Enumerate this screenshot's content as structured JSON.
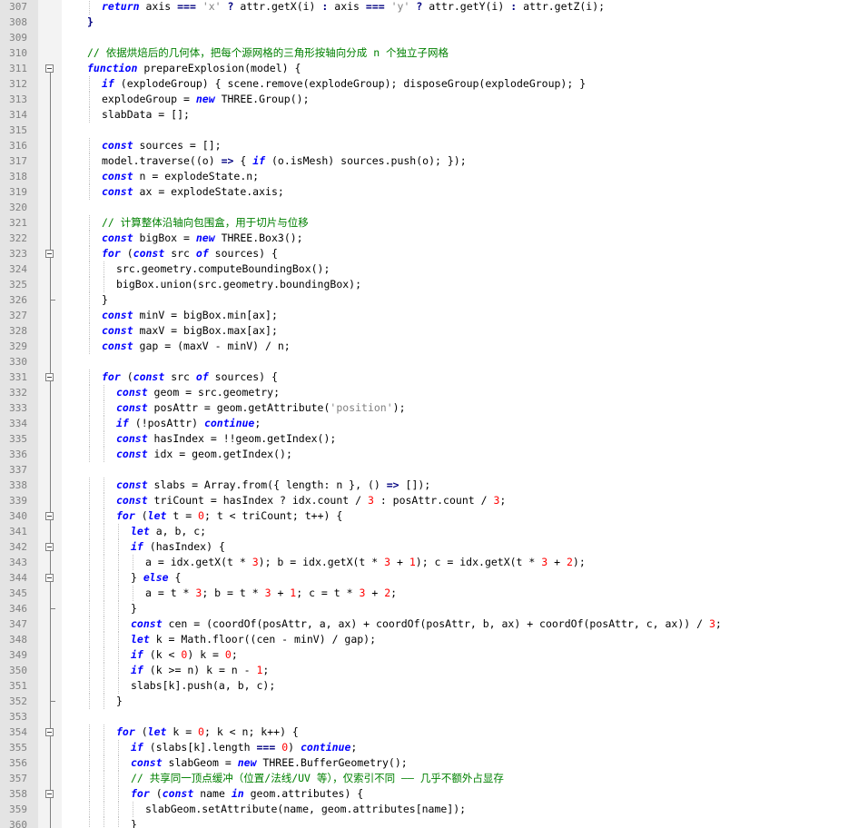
{
  "editor": {
    "first_line": 307,
    "lines": [
      {
        "n": "307",
        "indent": 4,
        "t": [
          [
            "kw",
            "return"
          ],
          [
            "p",
            " axis "
          ],
          [
            "op",
            "==="
          ],
          [
            "p",
            " "
          ],
          [
            "str",
            "'x'"
          ],
          [
            "p",
            " "
          ],
          [
            "op",
            "?"
          ],
          [
            "p",
            " attr.getX(i) "
          ],
          [
            "op",
            ":"
          ],
          [
            "p",
            " axis "
          ],
          [
            "op",
            "==="
          ],
          [
            "p",
            " "
          ],
          [
            "str",
            "'y'"
          ],
          [
            "p",
            " "
          ],
          [
            "op",
            "?"
          ],
          [
            "p",
            " attr.getY(i) "
          ],
          [
            "op",
            ":"
          ],
          [
            "p",
            " attr.getZ(i);"
          ]
        ]
      },
      {
        "n": "308",
        "indent": 2,
        "t": [
          [
            "op",
            "}"
          ]
        ]
      },
      {
        "n": "309",
        "indent": 0,
        "t": []
      },
      {
        "n": "310",
        "indent": 2,
        "t": [
          [
            "cm",
            "// 依据烘焙后的几何体，把每个源网格的三角形按轴向分成 n 个独立子网格"
          ]
        ]
      },
      {
        "n": "311",
        "indent": 2,
        "fold": "open",
        "t": [
          [
            "kw",
            "function"
          ],
          [
            "p",
            " prepareExplosion(model) {"
          ]
        ]
      },
      {
        "n": "312",
        "indent": 4,
        "t": [
          [
            "kw",
            "if"
          ],
          [
            "p",
            " (explodeGroup) { scene.remove(explodeGroup); disposeGroup(explodeGroup); }"
          ]
        ]
      },
      {
        "n": "313",
        "indent": 4,
        "t": [
          [
            "p",
            "explodeGroup = "
          ],
          [
            "kw",
            "new"
          ],
          [
            "p",
            " THREE.Group();"
          ]
        ]
      },
      {
        "n": "314",
        "indent": 4,
        "t": [
          [
            "p",
            "slabData = [];"
          ]
        ]
      },
      {
        "n": "315",
        "indent": 0,
        "t": []
      },
      {
        "n": "316",
        "indent": 4,
        "t": [
          [
            "kw",
            "const"
          ],
          [
            "p",
            " sources = [];"
          ]
        ]
      },
      {
        "n": "317",
        "indent": 4,
        "t": [
          [
            "p",
            "model.traverse((o) "
          ],
          [
            "op",
            "=>"
          ],
          [
            "p",
            " { "
          ],
          [
            "kw",
            "if"
          ],
          [
            "p",
            " (o.isMesh) sources.push(o); });"
          ]
        ]
      },
      {
        "n": "318",
        "indent": 4,
        "t": [
          [
            "kw",
            "const"
          ],
          [
            "p",
            " n = explodeState.n;"
          ]
        ]
      },
      {
        "n": "319",
        "indent": 4,
        "t": [
          [
            "kw",
            "const"
          ],
          [
            "p",
            " ax = explodeState.axis;"
          ]
        ]
      },
      {
        "n": "320",
        "indent": 0,
        "t": []
      },
      {
        "n": "321",
        "indent": 4,
        "t": [
          [
            "cm",
            "// 计算整体沿轴向包围盒，用于切片与位移"
          ]
        ]
      },
      {
        "n": "322",
        "indent": 4,
        "t": [
          [
            "kw",
            "const"
          ],
          [
            "p",
            " bigBox = "
          ],
          [
            "kw",
            "new"
          ],
          [
            "p",
            " THREE.Box3();"
          ]
        ]
      },
      {
        "n": "323",
        "indent": 4,
        "fold": "open",
        "t": [
          [
            "kw",
            "for"
          ],
          [
            "p",
            " ("
          ],
          [
            "kw",
            "const"
          ],
          [
            "p",
            " src "
          ],
          [
            "kw",
            "of"
          ],
          [
            "p",
            " sources) {"
          ]
        ]
      },
      {
        "n": "324",
        "indent": 6,
        "t": [
          [
            "p",
            "src.geometry.computeBoundingBox();"
          ]
        ]
      },
      {
        "n": "325",
        "indent": 6,
        "t": [
          [
            "p",
            "bigBox.union(src.geometry.boundingBox);"
          ]
        ]
      },
      {
        "n": "326",
        "indent": 4,
        "fold": "end",
        "t": [
          [
            "p",
            "}"
          ]
        ]
      },
      {
        "n": "327",
        "indent": 4,
        "t": [
          [
            "kw",
            "const"
          ],
          [
            "p",
            " minV = bigBox.min[ax];"
          ]
        ]
      },
      {
        "n": "328",
        "indent": 4,
        "t": [
          [
            "kw",
            "const"
          ],
          [
            "p",
            " maxV = bigBox.max[ax];"
          ]
        ]
      },
      {
        "n": "329",
        "indent": 4,
        "t": [
          [
            "kw",
            "const"
          ],
          [
            "p",
            " gap = (maxV - minV) / n;"
          ]
        ]
      },
      {
        "n": "330",
        "indent": 0,
        "t": []
      },
      {
        "n": "331",
        "indent": 4,
        "fold": "open",
        "t": [
          [
            "kw",
            "for"
          ],
          [
            "p",
            " ("
          ],
          [
            "kw",
            "const"
          ],
          [
            "p",
            " src "
          ],
          [
            "kw",
            "of"
          ],
          [
            "p",
            " sources) {"
          ]
        ]
      },
      {
        "n": "332",
        "indent": 6,
        "t": [
          [
            "kw",
            "const"
          ],
          [
            "p",
            " geom = src.geometry;"
          ]
        ]
      },
      {
        "n": "333",
        "indent": 6,
        "t": [
          [
            "kw",
            "const"
          ],
          [
            "p",
            " posAttr = geom.getAttribute("
          ],
          [
            "str",
            "'position'"
          ],
          [
            "p",
            ");"
          ]
        ]
      },
      {
        "n": "334",
        "indent": 6,
        "t": [
          [
            "kw",
            "if"
          ],
          [
            "p",
            " (!posAttr) "
          ],
          [
            "kw",
            "continue"
          ],
          [
            "p",
            ";"
          ]
        ]
      },
      {
        "n": "335",
        "indent": 6,
        "t": [
          [
            "kw",
            "const"
          ],
          [
            "p",
            " hasIndex = !!geom.getIndex();"
          ]
        ]
      },
      {
        "n": "336",
        "indent": 6,
        "t": [
          [
            "kw",
            "const"
          ],
          [
            "p",
            " idx = geom.getIndex();"
          ]
        ]
      },
      {
        "n": "337",
        "indent": 0,
        "t": []
      },
      {
        "n": "338",
        "indent": 6,
        "t": [
          [
            "kw",
            "const"
          ],
          [
            "p",
            " slabs = Array.from({ length: n }, () "
          ],
          [
            "op",
            "=>"
          ],
          [
            "p",
            " []);"
          ]
        ]
      },
      {
        "n": "339",
        "indent": 6,
        "t": [
          [
            "kw",
            "const"
          ],
          [
            "p",
            " triCount = hasIndex ? idx.count / "
          ],
          [
            "num",
            "3"
          ],
          [
            "p",
            " : posAttr.count / "
          ],
          [
            "num",
            "3"
          ],
          [
            "p",
            ";"
          ]
        ]
      },
      {
        "n": "340",
        "indent": 6,
        "fold": "open",
        "t": [
          [
            "kw",
            "for"
          ],
          [
            "p",
            " ("
          ],
          [
            "kw",
            "let"
          ],
          [
            "p",
            " t = "
          ],
          [
            "num",
            "0"
          ],
          [
            "p",
            "; t < triCount; t++) {"
          ]
        ]
      },
      {
        "n": "341",
        "indent": 8,
        "t": [
          [
            "kw",
            "let"
          ],
          [
            "p",
            " a, b, c;"
          ]
        ]
      },
      {
        "n": "342",
        "indent": 8,
        "fold": "open",
        "t": [
          [
            "kw",
            "if"
          ],
          [
            "p",
            " (hasIndex) {"
          ]
        ]
      },
      {
        "n": "343",
        "indent": 10,
        "t": [
          [
            "p",
            "a = idx.getX(t * "
          ],
          [
            "num",
            "3"
          ],
          [
            "p",
            "); b = idx.getX(t * "
          ],
          [
            "num",
            "3"
          ],
          [
            "p",
            " + "
          ],
          [
            "num",
            "1"
          ],
          [
            "p",
            "); c = idx.getX(t * "
          ],
          [
            "num",
            "3"
          ],
          [
            "p",
            " + "
          ],
          [
            "num",
            "2"
          ],
          [
            "p",
            ");"
          ]
        ]
      },
      {
        "n": "344",
        "indent": 8,
        "fold": "mid",
        "t": [
          [
            "p",
            "} "
          ],
          [
            "kw",
            "else"
          ],
          [
            "p",
            " {"
          ]
        ]
      },
      {
        "n": "345",
        "indent": 10,
        "t": [
          [
            "p",
            "a = t * "
          ],
          [
            "num",
            "3"
          ],
          [
            "p",
            "; b = t * "
          ],
          [
            "num",
            "3"
          ],
          [
            "p",
            " + "
          ],
          [
            "num",
            "1"
          ],
          [
            "p",
            "; c = t * "
          ],
          [
            "num",
            "3"
          ],
          [
            "p",
            " + "
          ],
          [
            "num",
            "2"
          ],
          [
            "p",
            ";"
          ]
        ]
      },
      {
        "n": "346",
        "indent": 8,
        "fold": "end",
        "t": [
          [
            "p",
            "}"
          ]
        ]
      },
      {
        "n": "347",
        "indent": 8,
        "t": [
          [
            "kw",
            "const"
          ],
          [
            "p",
            " cen = (coordOf(posAttr, a, ax) + coordOf(posAttr, b, ax) + coordOf(posAttr, c, ax)) / "
          ],
          [
            "num",
            "3"
          ],
          [
            "p",
            ";"
          ]
        ]
      },
      {
        "n": "348",
        "indent": 8,
        "t": [
          [
            "kw",
            "let"
          ],
          [
            "p",
            " k = Math.floor((cen - minV) / gap);"
          ]
        ]
      },
      {
        "n": "349",
        "indent": 8,
        "t": [
          [
            "kw",
            "if"
          ],
          [
            "p",
            " (k < "
          ],
          [
            "num",
            "0"
          ],
          [
            "p",
            ") k = "
          ],
          [
            "num",
            "0"
          ],
          [
            "p",
            ";"
          ]
        ]
      },
      {
        "n": "350",
        "indent": 8,
        "t": [
          [
            "kw",
            "if"
          ],
          [
            "p",
            " (k >= n) k = n - "
          ],
          [
            "num",
            "1"
          ],
          [
            "p",
            ";"
          ]
        ]
      },
      {
        "n": "351",
        "indent": 8,
        "t": [
          [
            "p",
            "slabs[k].push(a, b, c);"
          ]
        ]
      },
      {
        "n": "352",
        "indent": 6,
        "fold": "end",
        "t": [
          [
            "p",
            "}"
          ]
        ]
      },
      {
        "n": "353",
        "indent": 0,
        "t": []
      },
      {
        "n": "354",
        "indent": 6,
        "fold": "open",
        "t": [
          [
            "kw",
            "for"
          ],
          [
            "p",
            " ("
          ],
          [
            "kw",
            "let"
          ],
          [
            "p",
            " k = "
          ],
          [
            "num",
            "0"
          ],
          [
            "p",
            "; k < n; k++) {"
          ]
        ]
      },
      {
        "n": "355",
        "indent": 8,
        "t": [
          [
            "kw",
            "if"
          ],
          [
            "p",
            " (slabs[k].length "
          ],
          [
            "op",
            "==="
          ],
          [
            "p",
            " "
          ],
          [
            "num",
            "0"
          ],
          [
            "p",
            ") "
          ],
          [
            "kw",
            "continue"
          ],
          [
            "p",
            ";"
          ]
        ]
      },
      {
        "n": "356",
        "indent": 8,
        "t": [
          [
            "kw",
            "const"
          ],
          [
            "p",
            " slabGeom = "
          ],
          [
            "kw",
            "new"
          ],
          [
            "p",
            " THREE.BufferGeometry();"
          ]
        ]
      },
      {
        "n": "357",
        "indent": 8,
        "t": [
          [
            "cm",
            "// 共享同一顶点缓冲（位置/法线/UV 等），仅索引不同 —— 几乎不额外占显存"
          ]
        ]
      },
      {
        "n": "358",
        "indent": 8,
        "fold": "open",
        "t": [
          [
            "kw",
            "for"
          ],
          [
            "p",
            " ("
          ],
          [
            "kw",
            "const"
          ],
          [
            "p",
            " name "
          ],
          [
            "kw",
            "in"
          ],
          [
            "p",
            " geom.attributes) {"
          ]
        ]
      },
      {
        "n": "359",
        "indent": 10,
        "t": [
          [
            "p",
            "slabGeom.setAttribute(name, geom.attributes[name]);"
          ]
        ]
      },
      {
        "n": "360",
        "indent": 8,
        "t": [
          [
            "p",
            "}"
          ]
        ]
      }
    ]
  }
}
